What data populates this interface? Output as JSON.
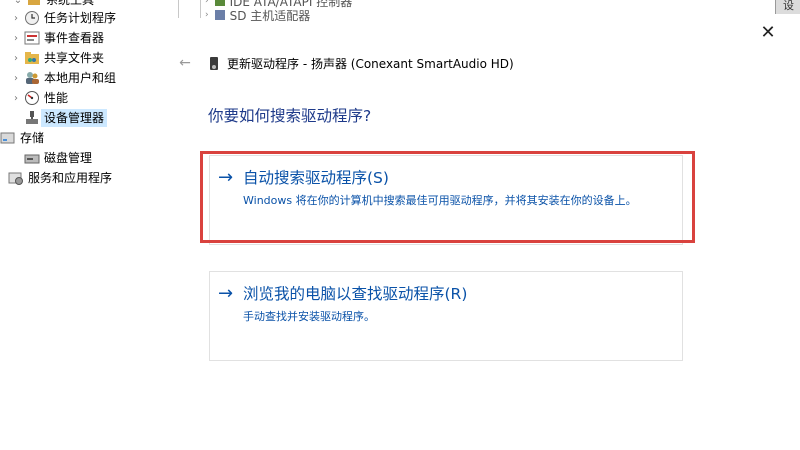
{
  "tree": {
    "items": [
      {
        "label": "系统工具",
        "icon": "gear-tools-icon",
        "indent": 0
      },
      {
        "label": "任务计划程序",
        "icon": "clock-icon",
        "indent": 1
      },
      {
        "label": "事件查看器",
        "icon": "event-viewer-icon",
        "indent": 1
      },
      {
        "label": "共享文件夹",
        "icon": "shared-folder-icon",
        "indent": 1
      },
      {
        "label": "本地用户和组",
        "icon": "users-icon",
        "indent": 1
      },
      {
        "label": "性能",
        "icon": "performance-icon",
        "indent": 1
      },
      {
        "label": "设备管理器",
        "icon": "device-manager-icon",
        "indent": 1
      },
      {
        "label": "存储",
        "icon": "storage-icon",
        "indent": 0
      },
      {
        "label": "磁盘管理",
        "icon": "disk-icon",
        "indent": 1
      },
      {
        "label": "服务和应用程序",
        "icon": "services-icon",
        "indent": 0
      }
    ]
  },
  "top_snippet": {
    "row1": "IDE ATA/ATAPI 控制器",
    "row2": "SD 主机适配器",
    "tab": "设"
  },
  "dialog": {
    "close_glyph": "✕",
    "back_glyph": "←",
    "title": "更新驱动程序 - 扬声器 (Conexant SmartAudio HD)",
    "heading": "你要如何搜索驱动程序?",
    "option1": {
      "arrow": "→",
      "title": "自动搜索驱动程序(S)",
      "desc": "Windows 将在你的计算机中搜索最佳可用驱动程序，并将其安装在你的设备上。"
    },
    "option2": {
      "arrow": "→",
      "title": "浏览我的电脑以查找驱动程序(R)",
      "desc": "手动查找并安装驱动程序。"
    }
  },
  "colors": {
    "link_blue": "#0a52a8",
    "heading_blue": "#1e3a8a",
    "highlight_red": "#d9423e",
    "selected_bg": "#cce8ff"
  }
}
